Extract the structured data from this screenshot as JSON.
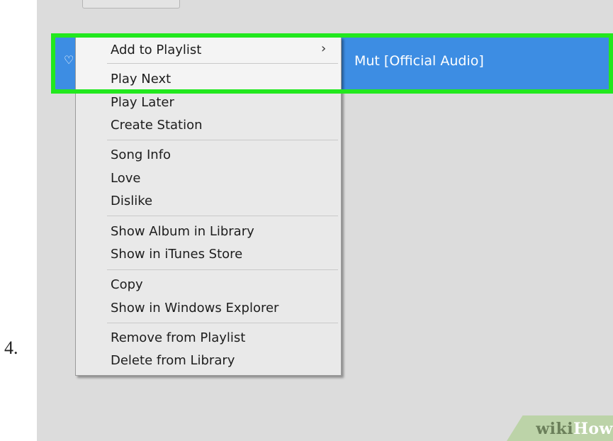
{
  "step": {
    "number": "4."
  },
  "song_row": {
    "title_partial": "Mut [Official Audio]"
  },
  "context_menu": {
    "items": [
      {
        "label": "Add to Playlist"
      },
      {
        "label": "Play Next"
      },
      {
        "label": "Play Later"
      },
      {
        "label": "Create Station"
      },
      {
        "label": "Song Info"
      },
      {
        "label": "Love"
      },
      {
        "label": "Dislike"
      },
      {
        "label": "Show Album in Library"
      },
      {
        "label": "Show in iTunes Store"
      },
      {
        "label": "Copy"
      },
      {
        "label": "Show in Windows Explorer"
      },
      {
        "label": "Remove from Playlist"
      },
      {
        "label": "Delete from Library"
      }
    ]
  },
  "colors": {
    "selection_blue": "#3d8de3",
    "highlight_green": "#22e81e",
    "menu_background": "#e9e9e9",
    "app_background": "#dcdcdc"
  },
  "icons": [
    "heart-icon",
    "chevron-right-icon"
  ],
  "watermark": {
    "part1": "wiki",
    "part2": "How"
  }
}
